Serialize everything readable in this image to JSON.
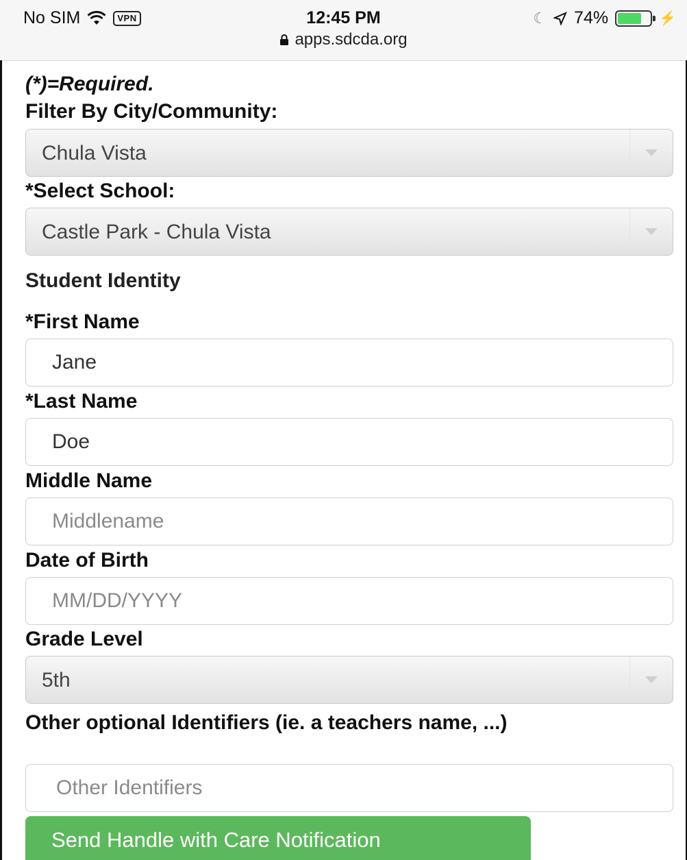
{
  "status_bar": {
    "carrier": "No SIM",
    "vpn": "VPN",
    "time": "12:45 PM",
    "battery": "74%",
    "battery_level": 0.74,
    "url": "apps.sdcda.org"
  },
  "form": {
    "required_note": "(*)=Required.",
    "city_label": "Filter By City/Community:",
    "city_value": "Chula Vista",
    "school_label": "*Select School:",
    "school_value": "Castle Park - Chula Vista",
    "section_title": "Student Identity",
    "first_name_label": "*First Name",
    "first_name_value": "Jane",
    "last_name_label": "*Last Name",
    "last_name_value": "Doe",
    "middle_name_label": "Middle Name",
    "middle_name_placeholder": "Middlename",
    "dob_label": "Date of Birth",
    "dob_placeholder": "MM/DD/YYYY",
    "grade_label": "Grade Level",
    "grade_value": "5th",
    "other_label": "Other optional Identifiers (ie. a teachers name, ...)",
    "other_placeholder": "Other Identifiers",
    "submit_label": "Send Handle with Care Notification"
  },
  "colors": {
    "button_green": "#5cb85c",
    "battery_green": "#4cd964"
  }
}
